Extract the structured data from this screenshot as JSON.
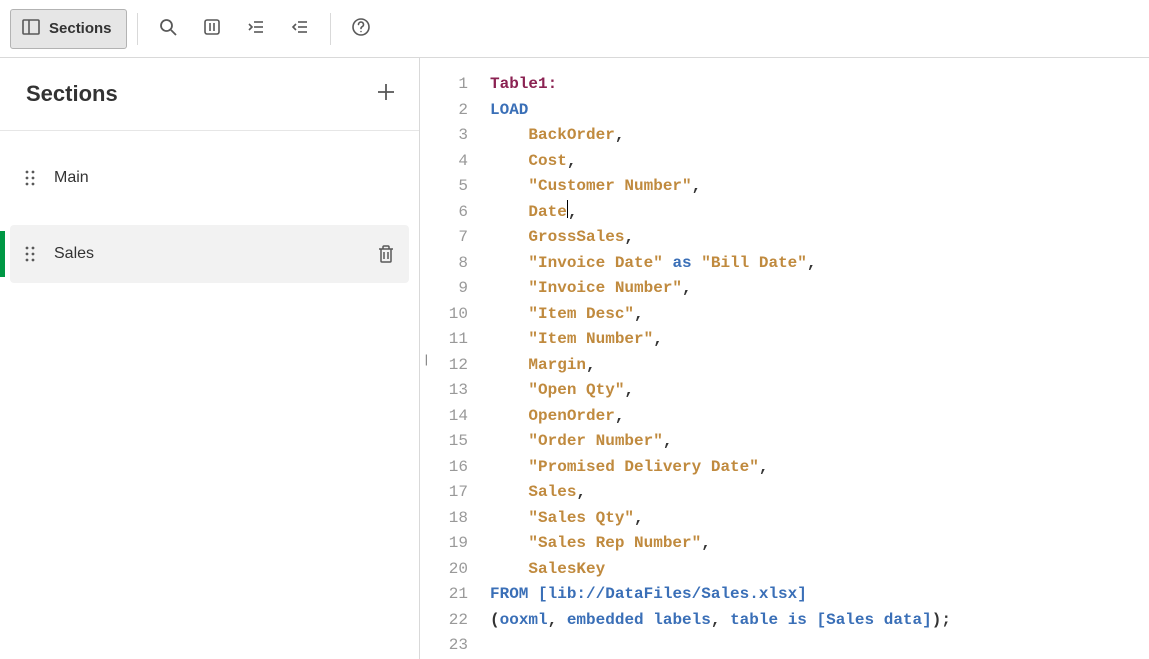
{
  "toolbar": {
    "sections_label": "Sections"
  },
  "sidebar": {
    "title": "Sections",
    "items": [
      {
        "label": "Main",
        "active": false
      },
      {
        "label": "Sales",
        "active": true
      }
    ]
  },
  "editor": {
    "cursor_line": 6,
    "lines": [
      {
        "n": 1,
        "tokens": [
          [
            "tablelabel",
            "Table1:"
          ]
        ]
      },
      {
        "n": 2,
        "tokens": [
          [
            "keyword",
            "LOAD"
          ]
        ]
      },
      {
        "n": 3,
        "tokens": [
          [
            "indent",
            "    "
          ],
          [
            "field",
            "BackOrder"
          ],
          [
            "punct",
            ","
          ]
        ]
      },
      {
        "n": 4,
        "tokens": [
          [
            "indent",
            "    "
          ],
          [
            "field",
            "Cost"
          ],
          [
            "punct",
            ","
          ]
        ]
      },
      {
        "n": 5,
        "tokens": [
          [
            "indent",
            "    "
          ],
          [
            "field",
            "\"Customer Number\""
          ],
          [
            "punct",
            ","
          ]
        ]
      },
      {
        "n": 6,
        "tokens": [
          [
            "indent",
            "    "
          ],
          [
            "field",
            "Date"
          ],
          [
            "cursor",
            ""
          ],
          [
            "punct",
            ","
          ]
        ]
      },
      {
        "n": 7,
        "tokens": [
          [
            "indent",
            "    "
          ],
          [
            "field",
            "GrossSales"
          ],
          [
            "punct",
            ","
          ]
        ]
      },
      {
        "n": 8,
        "tokens": [
          [
            "indent",
            "    "
          ],
          [
            "field",
            "\"Invoice Date\""
          ],
          [
            "punct",
            " "
          ],
          [
            "keyword",
            "as"
          ],
          [
            "punct",
            " "
          ],
          [
            "field",
            "\"Bill Date\""
          ],
          [
            "punct",
            ","
          ]
        ]
      },
      {
        "n": 9,
        "tokens": [
          [
            "indent",
            "    "
          ],
          [
            "field",
            "\"Invoice Number\""
          ],
          [
            "punct",
            ","
          ]
        ]
      },
      {
        "n": 10,
        "tokens": [
          [
            "indent",
            "    "
          ],
          [
            "field",
            "\"Item Desc\""
          ],
          [
            "punct",
            ","
          ]
        ]
      },
      {
        "n": 11,
        "tokens": [
          [
            "indent",
            "    "
          ],
          [
            "field",
            "\"Item Number\""
          ],
          [
            "punct",
            ","
          ]
        ]
      },
      {
        "n": 12,
        "tokens": [
          [
            "indent",
            "    "
          ],
          [
            "field",
            "Margin"
          ],
          [
            "punct",
            ","
          ]
        ]
      },
      {
        "n": 13,
        "tokens": [
          [
            "indent",
            "    "
          ],
          [
            "field",
            "\"Open Qty\""
          ],
          [
            "punct",
            ","
          ]
        ]
      },
      {
        "n": 14,
        "tokens": [
          [
            "indent",
            "    "
          ],
          [
            "field",
            "OpenOrder"
          ],
          [
            "punct",
            ","
          ]
        ]
      },
      {
        "n": 15,
        "tokens": [
          [
            "indent",
            "    "
          ],
          [
            "field",
            "\"Order Number\""
          ],
          [
            "punct",
            ","
          ]
        ]
      },
      {
        "n": 16,
        "tokens": [
          [
            "indent",
            "    "
          ],
          [
            "field",
            "\"Promised Delivery Date\""
          ],
          [
            "punct",
            ","
          ]
        ]
      },
      {
        "n": 17,
        "tokens": [
          [
            "indent",
            "    "
          ],
          [
            "field",
            "Sales"
          ],
          [
            "punct",
            ","
          ]
        ]
      },
      {
        "n": 18,
        "tokens": [
          [
            "indent",
            "    "
          ],
          [
            "field",
            "\"Sales Qty\""
          ],
          [
            "punct",
            ","
          ]
        ]
      },
      {
        "n": 19,
        "tokens": [
          [
            "indent",
            "    "
          ],
          [
            "field",
            "\"Sales Rep Number\""
          ],
          [
            "punct",
            ","
          ]
        ]
      },
      {
        "n": 20,
        "tokens": [
          [
            "indent",
            "    "
          ],
          [
            "field",
            "SalesKey"
          ]
        ]
      },
      {
        "n": 21,
        "tokens": [
          [
            "keyword",
            "FROM"
          ],
          [
            "punct",
            " "
          ],
          [
            "bracket",
            "[lib://DataFiles/Sales.xlsx]"
          ]
        ]
      },
      {
        "n": 22,
        "tokens": [
          [
            "punct",
            "("
          ],
          [
            "keyword",
            "ooxml"
          ],
          [
            "punct",
            ", "
          ],
          [
            "keyword",
            "embedded labels"
          ],
          [
            "punct",
            ", "
          ],
          [
            "keyword",
            "table"
          ],
          [
            "punct",
            " "
          ],
          [
            "is",
            "is"
          ],
          [
            "punct",
            " "
          ],
          [
            "bracket",
            "[Sales data]"
          ],
          [
            "punct",
            ");"
          ]
        ]
      },
      {
        "n": 23,
        "tokens": []
      }
    ]
  }
}
